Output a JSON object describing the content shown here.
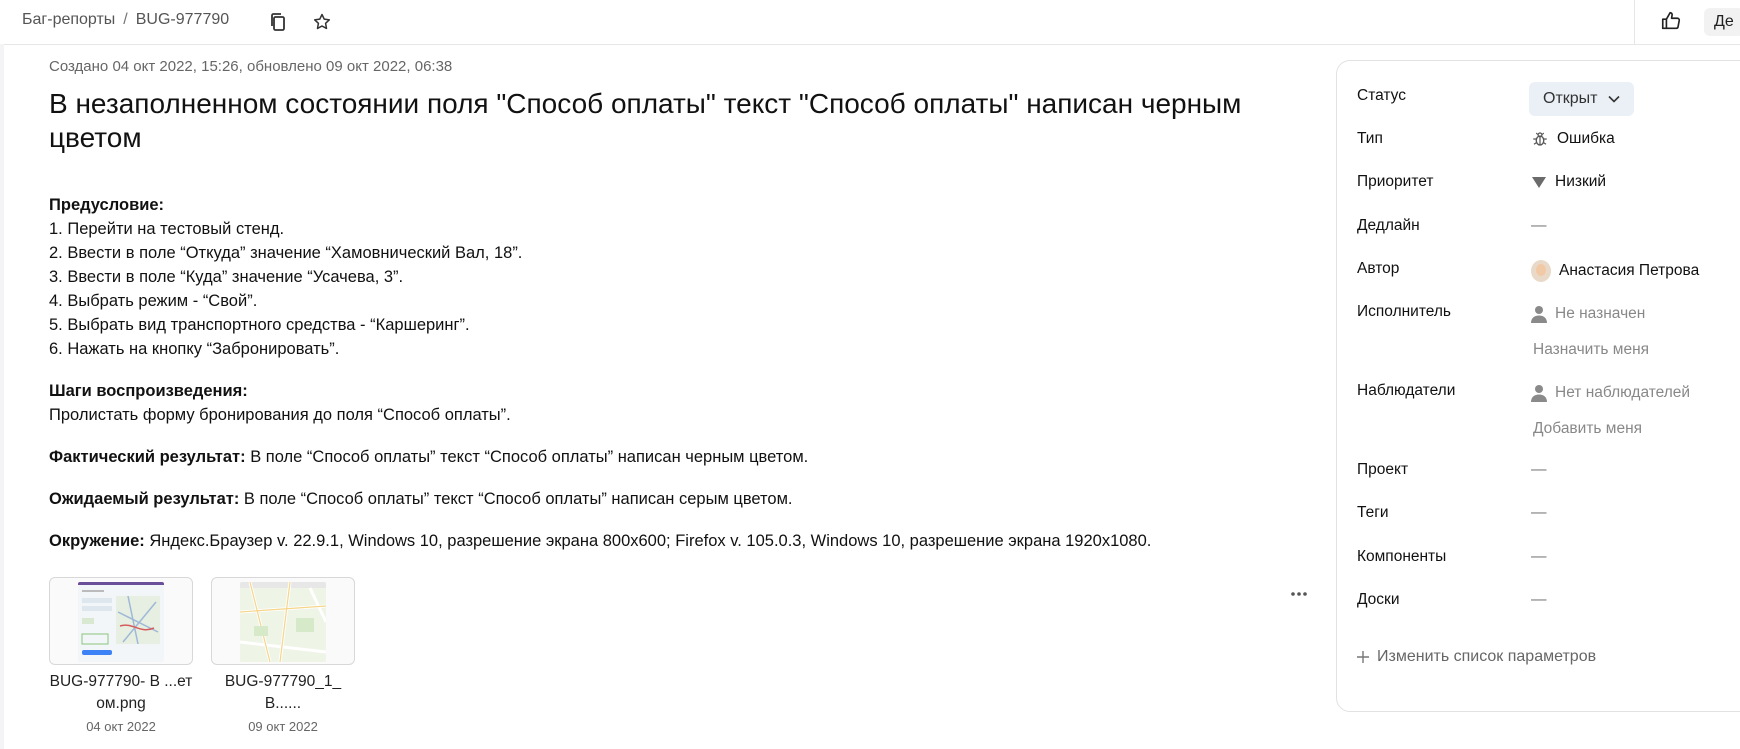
{
  "breadcrumb": {
    "section": "Баг-репорты",
    "separator": "/",
    "issue_key": "BUG-977790"
  },
  "header": {
    "action_label": "Де"
  },
  "issue": {
    "meta": "Создано 04 окт 2022, 15:26, обновлено 09 окт 2022, 06:38",
    "title": "В незаполненном состоянии поля \"Способ оплаты\" текст \"Способ оплаты\" написан черным цветом",
    "precondition_heading": "Предусловие:",
    "precondition_steps": [
      "1. Перейти на тестовый стенд.",
      "2. Ввести в поле “Откуда” значение “Хамовнический Вал, 18”.",
      "3. Ввести в поле “Куда” значение “Усачева, 3”.",
      "4. Выбрать режим - “Свой”.",
      "5. Выбрать вид транспортного средства - “Каршеринг”.",
      "6. Нажать на кнопку “Забронировать”."
    ],
    "steps_heading": "Шаги воспроизведения:",
    "steps_text": "Пролистать форму бронирования до поля “Способ оплаты”.",
    "actual_label": "Фактический результат:",
    "actual_text": " В поле “Способ оплаты” текст “Способ оплаты” написан черным цветом.",
    "expected_label": "Ожидаемый результат:",
    "expected_text": " В поле “Способ оплаты” текст “Способ оплаты” написан серым цветом.",
    "env_label": "Окружение:",
    "env_text": " Яндекс.Браузер v. 22.9.1, Windows 10, разрешение экрана 800x600; Firefox v. 105.0.3, Windows 10, разрешение экрана 1920x1080."
  },
  "attachments": [
    {
      "name": "BUG-977790- B ...етом.png",
      "date": "04 окт 2022"
    },
    {
      "name": "BUG-977790_1_B......",
      "date": "09 окт 2022"
    }
  ],
  "sidebar": {
    "status_label": "Статус",
    "status_value": "Открыт",
    "type_label": "Тип",
    "type_value": "Ошибка",
    "priority_label": "Приоритет",
    "priority_value": "Низкий",
    "deadline_label": "Дедлайн",
    "deadline_value": "—",
    "author_label": "Автор",
    "author_value": "Анастасия Петрова",
    "assignee_label": "Исполнитель",
    "assignee_value": "Не назначен",
    "assign_me": "Назначить меня",
    "watchers_label": "Наблюдатели",
    "watchers_value": "Нет наблюдателей",
    "add_me": "Добавить меня",
    "project_label": "Проект",
    "project_value": "—",
    "tags_label": "Теги",
    "tags_value": "—",
    "components_label": "Компоненты",
    "components_value": "—",
    "boards_label": "Доски",
    "boards_value": "—",
    "edit_params": "Изменить список параметров"
  },
  "icons": {
    "copy": "copy-icon",
    "star": "star-icon",
    "like": "thumbs-up-icon",
    "bug": "bug-icon",
    "priority_low": "triangle-down-icon",
    "user": "user-icon",
    "chevron": "chevron-down-icon",
    "more": "more-horizontal-icon",
    "plus": "plus-icon"
  }
}
